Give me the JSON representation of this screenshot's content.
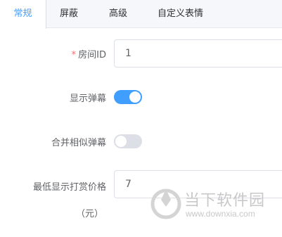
{
  "tabs": [
    {
      "label": "常规",
      "active": true
    },
    {
      "label": "屏蔽",
      "active": false
    },
    {
      "label": "高级",
      "active": false
    },
    {
      "label": "自定义表情",
      "active": false
    }
  ],
  "form": {
    "room_id": {
      "required_mark": "*",
      "label": "房间ID",
      "value": "1"
    },
    "show_danmaku": {
      "label": "显示弹幕",
      "enabled": true
    },
    "merge_similar": {
      "label": "合并相似弹幕",
      "enabled": false
    },
    "min_reward_price": {
      "label": "最低显示打赏价格",
      "unit_label": "（元）",
      "value": "7"
    }
  },
  "watermark": {
    "text": "当下软件园",
    "url": "www.downxia.com"
  },
  "colors": {
    "accent": "#409eff",
    "required": "#f56c6c",
    "switch_off": "#dcdfe6"
  }
}
